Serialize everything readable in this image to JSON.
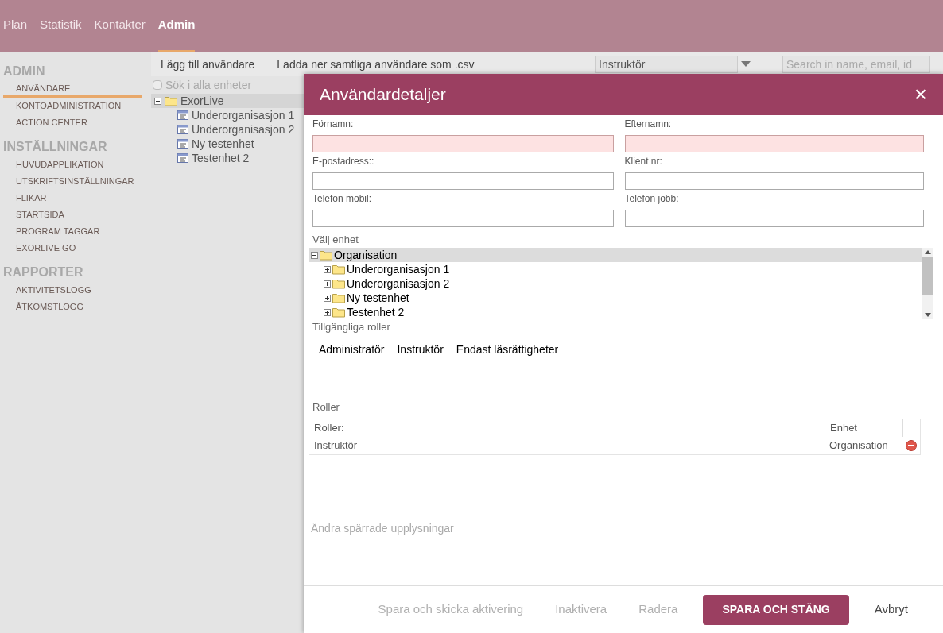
{
  "nav": [
    {
      "label": "Plan",
      "selected": false
    },
    {
      "label": "Statistik",
      "selected": false
    },
    {
      "label": "Kontakter",
      "selected": false
    },
    {
      "label": "Admin",
      "selected": true
    }
  ],
  "sidebar": [
    {
      "heading": "ADMIN",
      "items": [
        {
          "label": "ANVÄNDARE",
          "selected": true
        },
        {
          "label": "KONTOADMINISTRATION",
          "selected": false
        },
        {
          "label": "ACTION CENTER",
          "selected": false
        }
      ]
    },
    {
      "heading": "INSTÄLLNINGAR",
      "items": [
        {
          "label": "HUVUDAPPLIKATION",
          "selected": false
        },
        {
          "label": "UTSKRIFTSINSTÄLLNINGAR",
          "selected": false
        },
        {
          "label": "FLIKAR",
          "selected": false
        },
        {
          "label": "STARTSIDA",
          "selected": false
        },
        {
          "label": "PROGRAM TAGGAR",
          "selected": false
        },
        {
          "label": "EXORLIVE GO",
          "selected": false
        }
      ]
    },
    {
      "heading": "RAPPORTER",
      "items": [
        {
          "label": "AKTIVITETSLOGG",
          "selected": false
        },
        {
          "label": "ÅTKOMSTLOGG",
          "selected": false
        }
      ]
    }
  ],
  "toolbar": {
    "actions": [
      "Lägg till användare",
      "Ladda ner samtliga användare som .csv"
    ],
    "role_filter": "Instruktör",
    "search": {
      "placeholder": "Search in name, email, id"
    }
  },
  "unit_search": {
    "label": "Sök i alla enheter",
    "checked": false
  },
  "unit_tree": {
    "label": "ExorLive",
    "expanded": true,
    "children": [
      {
        "label": "Underorganisasjon 1"
      },
      {
        "label": "Underorganisasjon 2"
      },
      {
        "label": "Ny testenhet"
      },
      {
        "label": "Testenhet 2"
      }
    ]
  },
  "dialog": {
    "title": "Användardetaljer",
    "close": "×",
    "fields": [
      {
        "label": "Förnamn:",
        "required": true
      },
      {
        "label": "Efternamn:",
        "required": true
      },
      {
        "label": "E-postadress::",
        "required": false
      },
      {
        "label": "Klient nr:",
        "required": false
      },
      {
        "label": "Telefon mobil:",
        "required": false
      },
      {
        "label": "Telefon jobb:",
        "required": false
      }
    ],
    "unit_label": "Välj enhet",
    "unit_tree": {
      "label": "Organisation",
      "expanded": true,
      "selected": true,
      "children": [
        {
          "label": "Underorganisasjon 1",
          "expanded": false
        },
        {
          "label": "Underorganisasjon 2",
          "expanded": false
        },
        {
          "label": "Ny testenhet",
          "expanded": false
        },
        {
          "label": "Testenhet 2",
          "expanded": false
        }
      ]
    },
    "roles_label": "Tillgängliga roller",
    "available_roles": [
      "Administratör",
      "Instruktör",
      "Endast läsrättigheter"
    ],
    "assigned_label": "Roller",
    "table": {
      "columns": [
        "Roller:",
        "Enhet"
      ],
      "rows": [
        {
          "role": "Instruktör",
          "unit": "Organisation"
        }
      ]
    },
    "locked_info": "Ändra spärrade upplysningar",
    "buttons": [
      {
        "label": "Spara och skicka aktivering",
        "kind": "plain",
        "disabled": true
      },
      {
        "label": "Inaktivera",
        "kind": "plain",
        "disabled": true
      },
      {
        "label": "Radera",
        "kind": "plain",
        "disabled": true
      },
      {
        "label": "SPARA OCH STÄNG",
        "kind": "primary",
        "disabled": false
      },
      {
        "label": "Avbryt",
        "kind": "plain",
        "disabled": false
      }
    ]
  }
}
